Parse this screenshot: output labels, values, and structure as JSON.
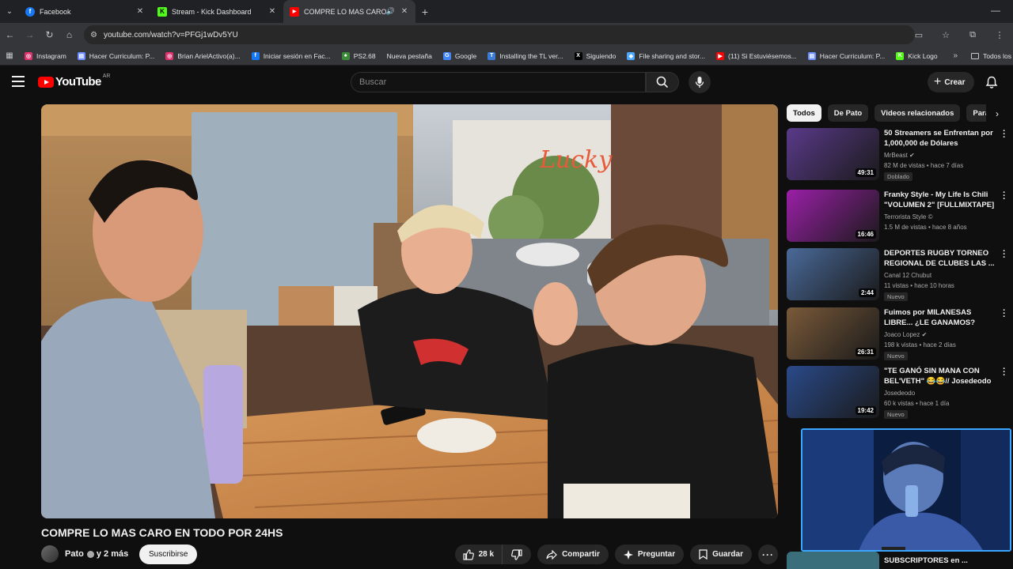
{
  "browser": {
    "tabs": [
      {
        "label": "Facebook",
        "color": "#1877f2",
        "glyph": "f"
      },
      {
        "label": "Stream - Kick Dashboard",
        "color": "#53fc18",
        "glyph": "K"
      },
      {
        "label": "COMPRE LO MAS CARO EN",
        "color": "#ff0000",
        "glyph": "▶",
        "active": true
      }
    ],
    "url": "youtube.com/watch?v=PFGj1wDv5YU",
    "bookmarks": [
      {
        "label": "Instagram",
        "color": "#e1306c",
        "glyph": "◎"
      },
      {
        "label": "Hacer Curriculum: P...",
        "color": "#6c8cff",
        "glyph": "▤"
      },
      {
        "label": "Brian ArielActivo(a)...",
        "color": "#e1306c",
        "glyph": "◎"
      },
      {
        "label": "Iniciar sesión en Fac...",
        "color": "#1877f2",
        "glyph": "f"
      },
      {
        "label": "PS2.68",
        "color": "#3a8a3a",
        "glyph": "♠"
      },
      {
        "label": "Nueva pestaña",
        "color": "",
        "glyph": ""
      },
      {
        "label": "Google",
        "color": "#4285f4",
        "glyph": "G"
      },
      {
        "label": "Installing the TL ver...",
        "color": "#3b7bd5",
        "glyph": "T"
      },
      {
        "label": "Siguiendo",
        "color": "#000000",
        "glyph": "X"
      },
      {
        "label": "File sharing and stor...",
        "color": "#4aa8ff",
        "glyph": "◆"
      },
      {
        "label": "(11) Si Estuviésemos...",
        "color": "#ff0000",
        "glyph": "▶"
      },
      {
        "label": "Hacer Curriculum: P...",
        "color": "#6c8cff",
        "glyph": "▤"
      },
      {
        "label": "Kick Logo",
        "color": "#53fc18",
        "glyph": "K"
      }
    ],
    "all_bookmarks": "Todos los"
  },
  "masthead": {
    "logo_text": "YouTube",
    "country": "AR",
    "search_placeholder": "Buscar",
    "create_label": "Crear"
  },
  "video": {
    "title": "COMPRE LO MAS CARO EN TODO POR 24HS",
    "channel": "Pato",
    "channel_suffix": "y 2 más",
    "subscribe_label": "Suscribirse",
    "likes": "28 k",
    "share_label": "Compartir",
    "ask_label": "Preguntar",
    "save_label": "Guardar",
    "scene_sign": "Lucky"
  },
  "sidebar": {
    "chips": [
      "Todos",
      "De Pato",
      "Videos relacionados",
      "Para"
    ],
    "recommendations": [
      {
        "title": "50 Streamers se Enfrentan por 1,000,000 de Dólares",
        "channel": "MrBeast",
        "verified": true,
        "meta": "82 M de vistas • hace 7 días",
        "badge": "Doblado",
        "duration": "49:31",
        "thumb": "#5a3a8a"
      },
      {
        "title": "Franky Style - My Life Is Chili \"VOLUMEN 2\" [FULLMIXTAPE]",
        "channel": "Terrorista Style ©",
        "verified": false,
        "meta": "1.5 M de vistas • hace 8 años",
        "badge": "",
        "duration": "16:46",
        "thumb": "#9b1fa8"
      },
      {
        "title": "DEPORTES RUGBY TORNEO REGIONAL DE CLUBES  LAS ...",
        "channel": "Canal 12 Chubut",
        "verified": false,
        "meta": "11 vistas • hace 10 horas",
        "badge": "Nuevo",
        "duration": "2:44",
        "thumb": "#4a6a9a"
      },
      {
        "title": "Fuimos por MILANESAS LIBRE... ¿LE GANAMOS?",
        "channel": "Joaco Lopez",
        "verified": true,
        "meta": "198 k vistas • hace 2 días",
        "badge": "Nuevo",
        "duration": "26:31",
        "thumb": "#7a5a3a"
      },
      {
        "title": "\"TE GANÓ SIN MANA CON BEL'VETH\" 😂😂// Josedeodo",
        "channel": "Josedeodo",
        "verified": false,
        "meta": "60 k vistas • hace 1 día",
        "badge": "Nuevo",
        "duration": "19:42",
        "thumb": "#2a4a8a"
      }
    ],
    "partial_title": "SUBSCRIPTORES en ..."
  }
}
